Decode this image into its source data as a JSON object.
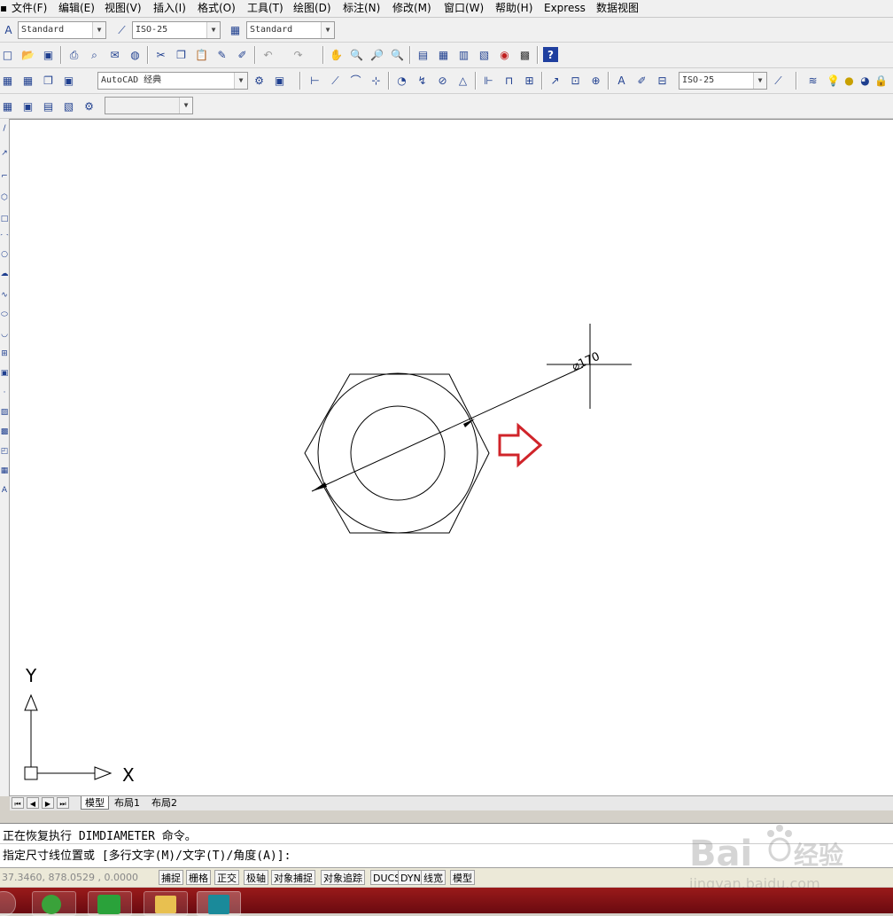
{
  "menu": [
    "文件(F)",
    "编辑(E)",
    "视图(V)",
    "插入(I)",
    "格式(O)",
    "工具(T)",
    "绘图(D)",
    "标注(N)",
    "修改(M)",
    "窗口(W)",
    "帮助(H)",
    "Express",
    "数据视图"
  ],
  "styles_toolbar": {
    "text_style": "Standard",
    "dim_style": "ISO-25",
    "table_style": "Standard"
  },
  "workspace_toolbar": {
    "workspace": "AutoCAD 经典",
    "dim_style": "ISO-25"
  },
  "layer_toolbar": {
    "layer_value": ""
  },
  "drawing": {
    "dimension_text": "⌀170",
    "ucs_x": "X",
    "ucs_y": "Y",
    "arrow_color": "#d0242a"
  },
  "tabs": [
    "模型",
    "布局1",
    "布局2"
  ],
  "command": {
    "line1": "正在恢复执行 DIMDIAMETER 命令。",
    "line2": "指定尺寸线位置或 [多行文字(M)/文字(T)/角度(A)]:"
  },
  "status": {
    "coords": "37.3460, 878.0529 , 0.0000",
    "toggles": [
      "捕捉",
      "栅格",
      "正交",
      "极轴",
      "对象捕捉",
      "对象追踪",
      "DUCS",
      "DYN",
      "线宽",
      "模型"
    ]
  },
  "watermark": {
    "brand": "Bai",
    "brand_cn": "经验",
    "url": "jingyan.baidu.com"
  },
  "taskbar": {
    "items": [
      "start",
      "browser",
      "iqiyi",
      "folder",
      "autocad"
    ]
  },
  "icons": {
    "toolbar1": [
      "text-style-icon",
      "dim-style-icon",
      "table-style-icon"
    ],
    "toolbar2": [
      "new-icon",
      "open-icon",
      "save-icon",
      "print-icon",
      "preview-icon",
      "publish-icon",
      "plot-icon",
      "cut-icon",
      "copy-icon",
      "paste-icon",
      "matchprop-icon",
      "blockeditor-icon",
      "undo-icon",
      "redo-icon",
      "pan-icon",
      "zoom-realtime-icon",
      "zoom-window-icon",
      "zoom-previous-icon",
      "properties-icon",
      "designcenter-icon",
      "toolpalettes-icon",
      "sheetset-icon",
      "markup-icon",
      "calculator-icon",
      "help-icon"
    ]
  }
}
